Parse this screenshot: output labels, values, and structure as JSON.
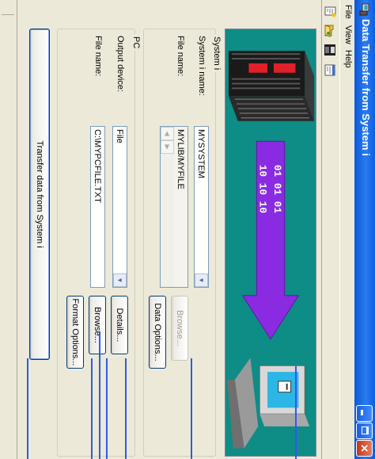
{
  "window": {
    "title": "Data Transfer from System i"
  },
  "menu": [
    "File",
    "View",
    "Help"
  ],
  "toolbar": [
    "new-transfer-icon",
    "open-icon",
    "save-icon",
    "properties-icon"
  ],
  "system_group": {
    "label": "System i",
    "system_name_label": "System i name:",
    "system_name_value": "MYSYSTEM",
    "file_name_label": "File name:",
    "file_name_value": "MYLIB/MYFILE",
    "browse_label": "Browse...",
    "data_options_label": "Data Options..."
  },
  "pc_group": {
    "label": "PC",
    "output_device_label": "Output device:",
    "output_device_value": "File",
    "details_label": "Details...",
    "file_name_label": "File name:",
    "file_name_value": "C:\\MYPCFILE.TXT",
    "browse_label": "Browse...",
    "format_options_label": "Format Options..."
  },
  "transfer_button_label": "Transfer data from System i",
  "colors": {
    "titlebar": "#0a5fe4",
    "dialog_bg": "#ece9d8",
    "banner": "#0e8c86",
    "arrow": "#2a5cf0",
    "server_red": "#e0202a",
    "transfer_arrow": "#8a2be2"
  },
  "banner_art": {
    "bits_top": "01  01  01",
    "bits_bottom": "10  10  10"
  }
}
